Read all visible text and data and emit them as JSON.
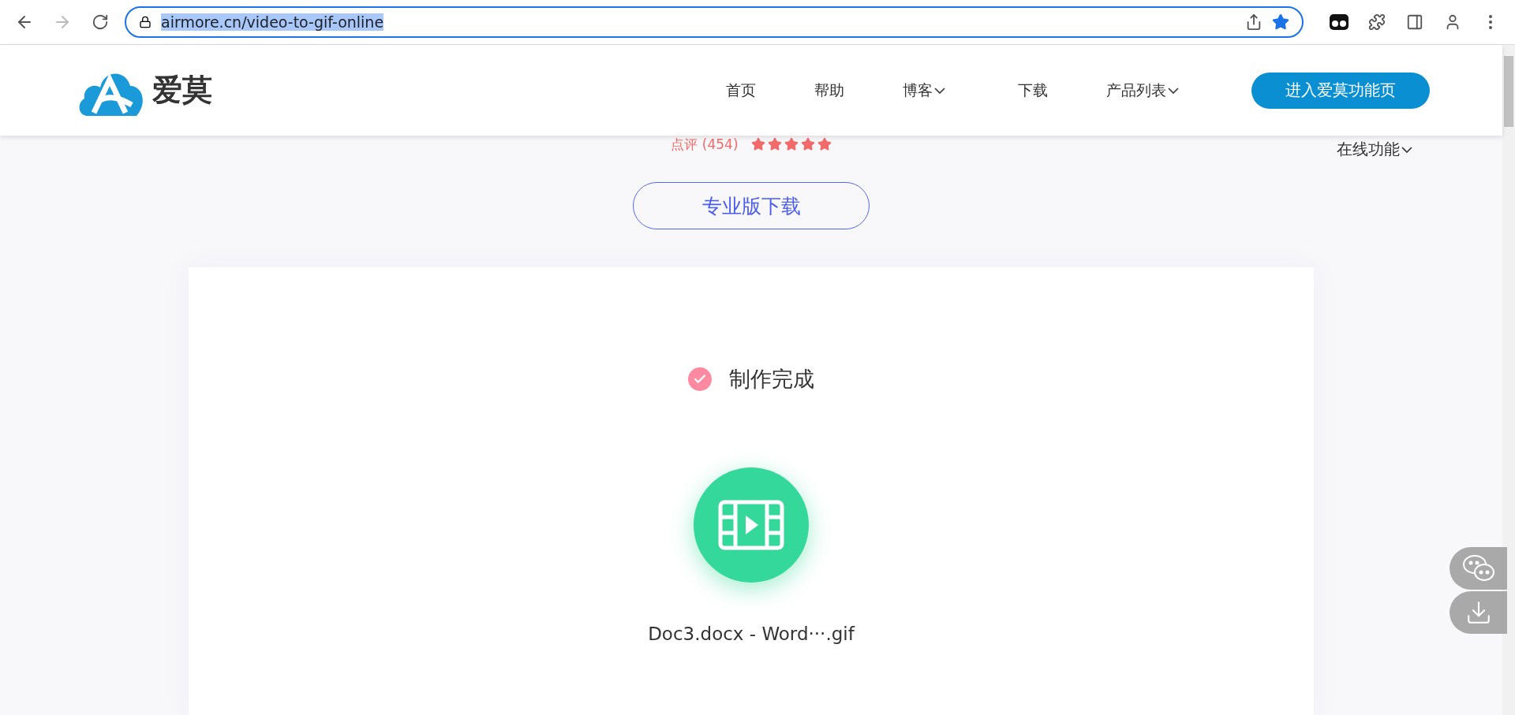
{
  "browser": {
    "url": "airmore.cn/video-to-gif-online",
    "url_selected": true,
    "bookmarked": true,
    "forward_disabled": true
  },
  "header": {
    "logo_text": "爱莫",
    "nav": [
      {
        "label": "首页",
        "dropdown": false
      },
      {
        "label": "帮助",
        "dropdown": false
      },
      {
        "label": "博客",
        "dropdown": true
      },
      {
        "label": "下载",
        "dropdown": false
      },
      {
        "label": "产品列表",
        "dropdown": true
      }
    ],
    "cta": "进入爱莫功能页"
  },
  "rating": {
    "label": "点评 (454)",
    "stars": 5
  },
  "side_menu": {
    "label": "在线功能",
    "dropdown": true
  },
  "pro_download": "专业版下载",
  "result": {
    "status": "制作完成",
    "filename": "Doc3.docx - Word···.gif"
  }
}
